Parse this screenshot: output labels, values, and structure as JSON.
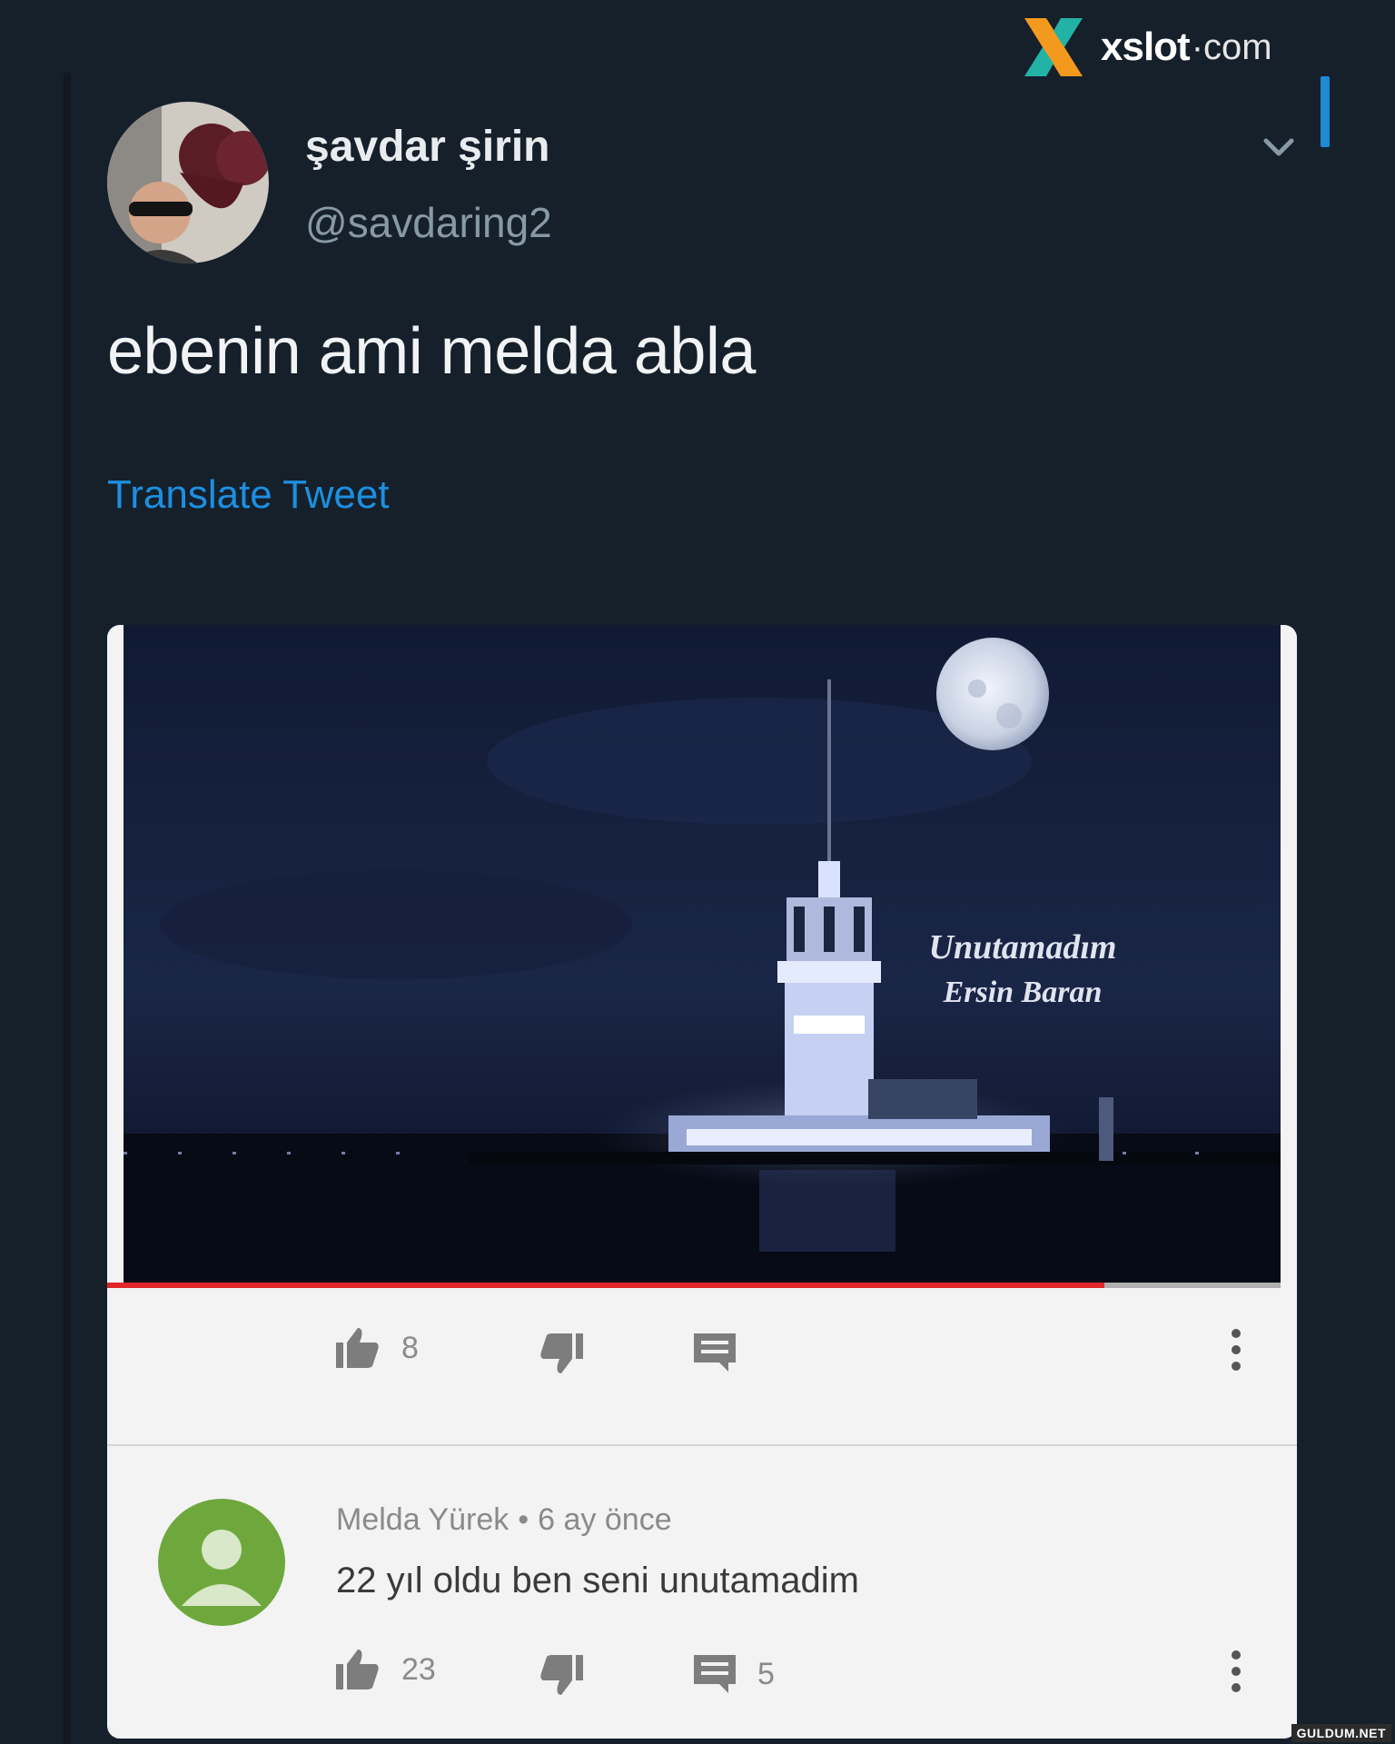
{
  "brand": {
    "name": "xslot",
    "dot": "·",
    "tld": "com"
  },
  "tweet": {
    "display_name": "şavdar şirin",
    "handle": "@savdaring2",
    "text": "ebenin ami melda abla",
    "translate_label": "Translate Tweet"
  },
  "video": {
    "title_overlay": "Unutamadım",
    "artist_overlay": "Ersin Baran",
    "progress": 0.85,
    "likes": "8"
  },
  "comment": {
    "author": "Melda Yürek",
    "separator": "•",
    "time": "6 ay önce",
    "text": "22 yıl oldu ben seni unutamadim",
    "likes": "23",
    "replies": "5"
  },
  "watermark": "GULDUM.NET",
  "colors": {
    "background": "#15202b",
    "link": "#1d8fe0",
    "progress": "#e0262b",
    "accent_orange": "#f39a1e",
    "accent_teal": "#22b3a6"
  }
}
